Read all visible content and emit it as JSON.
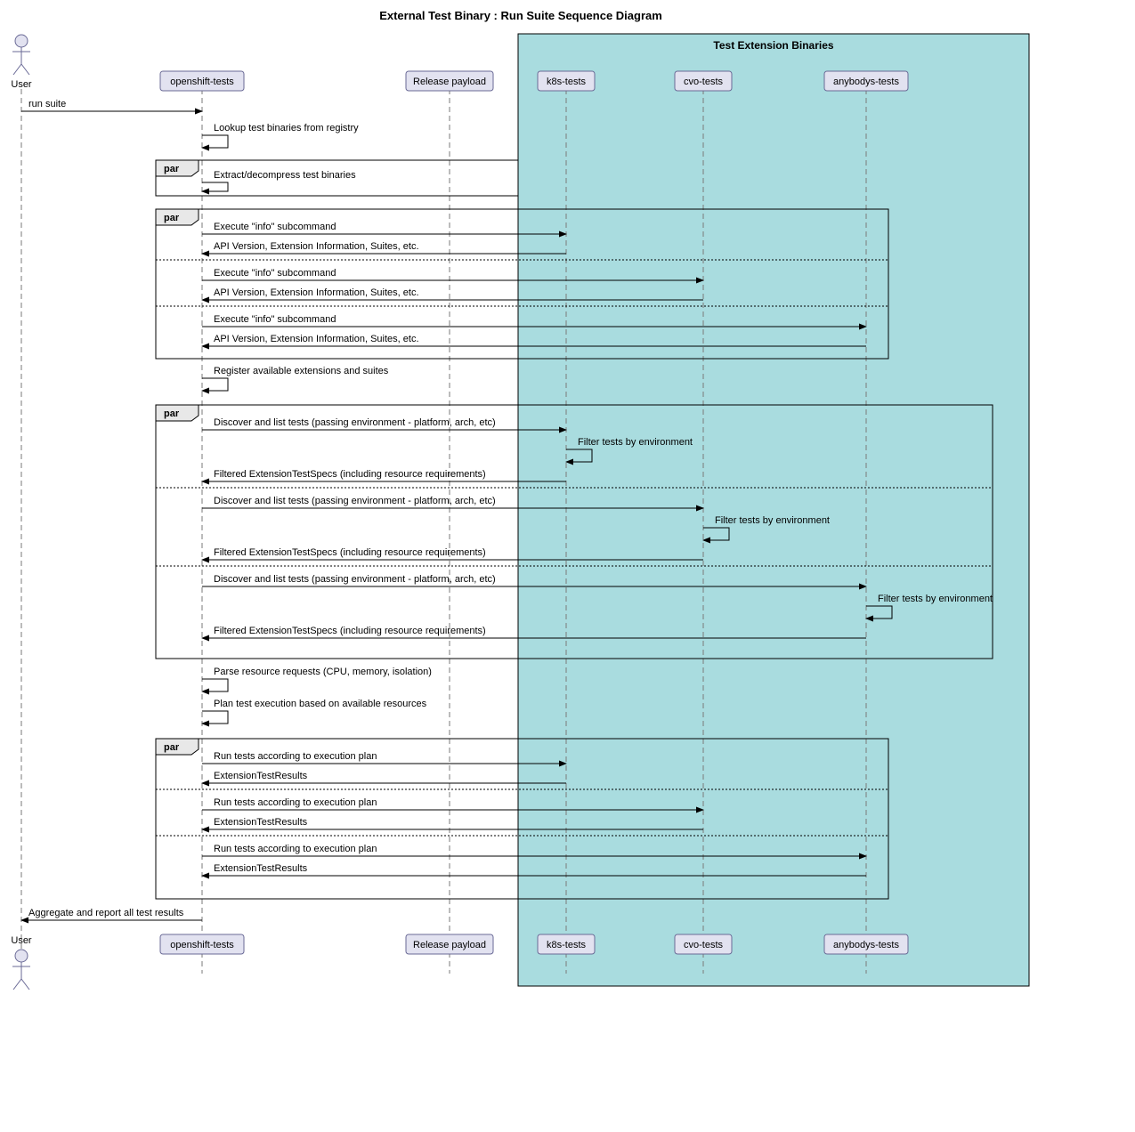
{
  "title": "External Test Binary : Run Suite Sequence Diagram",
  "group_label": "Test Extension Binaries",
  "actors": {
    "user": "User",
    "openshift": "openshift-tests",
    "release": "Release payload",
    "k8s": "k8s-tests",
    "cvo": "cvo-tests",
    "anybodys": "anybodys-tests"
  },
  "par_label": "par",
  "messages": {
    "run_suite": "run suite",
    "lookup": "Lookup test binaries from registry",
    "extract": "Extract/decompress test binaries",
    "exec_info": "Execute \"info\" subcommand",
    "api_version": "API Version, Extension Information, Suites, etc.",
    "register": "Register available extensions and suites",
    "discover": "Discover and list tests (passing environment - platform, arch, etc)",
    "filter": "Filter tests by environment",
    "filtered": "Filtered ExtensionTestSpecs (including resource requirements)",
    "parse": "Parse resource requests (CPU, memory, isolation)",
    "plan": "Plan test execution based on available resources",
    "run_tests": "Run tests according to execution plan",
    "results": "ExtensionTestResults",
    "aggregate": "Aggregate and report all test results"
  },
  "colors": {
    "participant_fill": "#e2e2f0",
    "participant_stroke": "#6a6a96",
    "group_fill": "#a9dcdf",
    "group_stroke": "#000000"
  }
}
